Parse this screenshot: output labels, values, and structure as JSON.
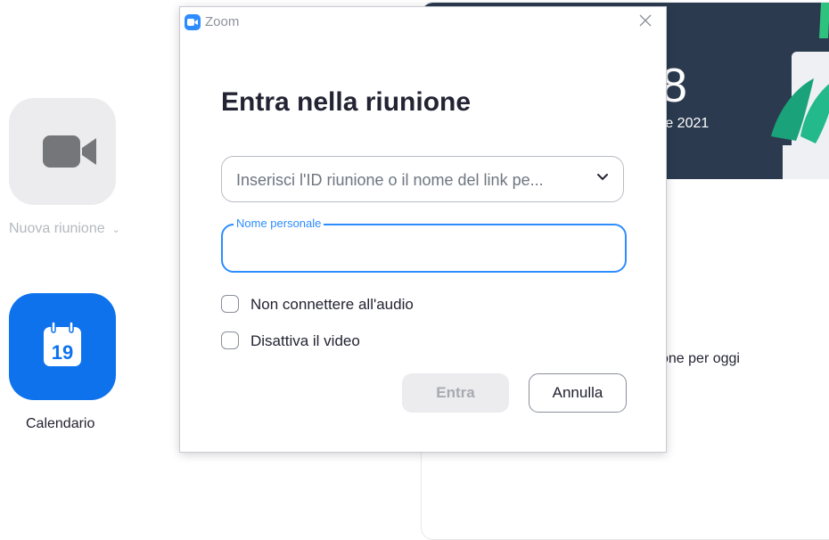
{
  "home": {
    "new_meeting_label": "Nuova riunione",
    "new_meeting_chevron": "⌄",
    "calendar_label": "Calendario",
    "calendar_day": "19",
    "banner_time_fragment": "8",
    "banner_date_fragment": "re 2021",
    "upcoming_fragment": "one per oggi"
  },
  "dialog": {
    "window_title": "Zoom",
    "heading": "Entra nella riunione",
    "meeting_id_placeholder": "Inserisci l'ID riunione o il nome del link pe...",
    "meeting_id_value": "",
    "name_label": "Nome personale",
    "name_value": "",
    "options": [
      {
        "label": "Non connettere all'audio",
        "checked": false
      },
      {
        "label": "Disattiva il video",
        "checked": false
      }
    ],
    "join_label": "Entra",
    "cancel_label": "Annulla"
  },
  "icons": {
    "app": "zoom-logo-icon",
    "close": "close-icon",
    "dropdown": "chevron-down-icon",
    "camera": "video-camera-icon",
    "calendar": "calendar-icon"
  },
  "colors": {
    "accent": "#2d8cff",
    "calendar_tile": "#0e72ed",
    "banner": "#2b3a4f",
    "disabled_button": "#ececef"
  }
}
